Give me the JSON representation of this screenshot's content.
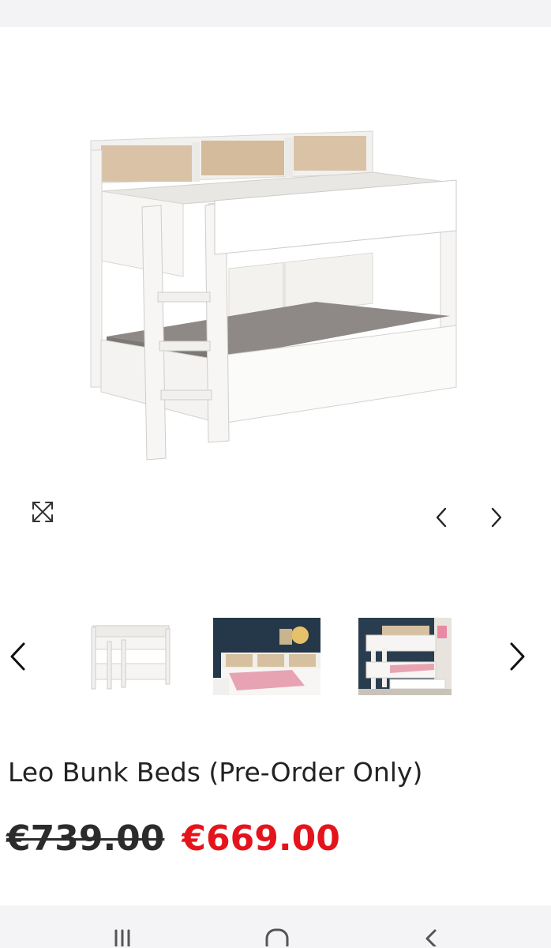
{
  "product": {
    "title": "Leo Bunk Beds (Pre-Order Only)",
    "old_price": "€739.00",
    "new_price": "€669.00"
  },
  "gallery": {
    "main_image": "white bunk bed with shelves and ladder",
    "thumbnails": [
      {
        "alt": "white bunk bed"
      },
      {
        "alt": "bunk bed in room with pink bedding"
      },
      {
        "alt": "bunk bed in room with trundle drawer"
      }
    ]
  },
  "icons": {
    "expand": "expand-icon",
    "prev": "chevron-left-icon",
    "next": "chevron-right-icon"
  },
  "colors": {
    "sale_price": "#e5141c",
    "text": "#222222",
    "nav_bar": "#f4f4f6"
  }
}
